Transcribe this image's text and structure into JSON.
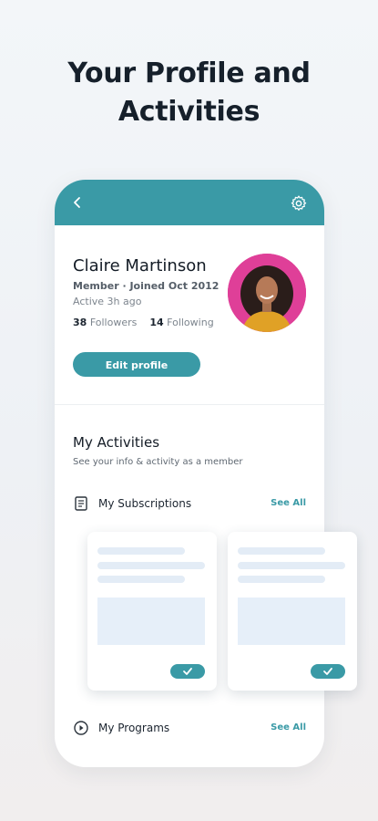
{
  "headline": {
    "line1": "Your Profile and",
    "line2": "Activities"
  },
  "topbar": {
    "back_icon": "chevron-left-icon",
    "settings_icon": "gear-icon"
  },
  "profile": {
    "name": "Claire Martinson",
    "meta": "Member · Joined Oct 2012",
    "active": "Active 3h ago",
    "followers_count": "38",
    "followers_label": "Followers",
    "following_count": "14",
    "following_label": "Following",
    "edit_label": "Edit profile"
  },
  "activities": {
    "title": "My Activities",
    "subtitle": "See your info & activity as a member",
    "subscriptions": {
      "label": "My Subscriptions",
      "see_all": "See All",
      "icon": "document-list-icon"
    },
    "programs": {
      "label": "My Programs",
      "see_all": "See All",
      "icon": "play-circle-icon"
    }
  },
  "colors": {
    "accent": "#3a9aa6",
    "avatar_bg": "#df3f98"
  }
}
